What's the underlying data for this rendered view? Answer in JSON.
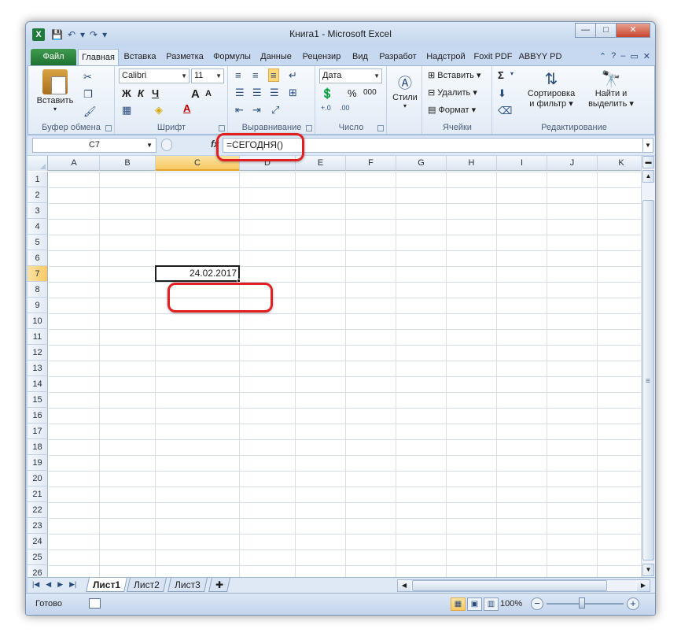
{
  "window": {
    "title": "Книга1 - Microsoft Excel",
    "app_icon_letter": "X",
    "controls": {
      "minimize": "—",
      "maximize": "□",
      "close": "✕"
    }
  },
  "qat": {
    "save": "💾",
    "undo": "↶",
    "redo": "↷",
    "more": "▾"
  },
  "tabs": [
    {
      "label": "Файл"
    },
    {
      "label": "Главная"
    },
    {
      "label": "Вставка"
    },
    {
      "label": "Разметка"
    },
    {
      "label": "Формулы"
    },
    {
      "label": "Данные"
    },
    {
      "label": "Рецензир"
    },
    {
      "label": "Вид"
    },
    {
      "label": "Разработ"
    },
    {
      "label": "Надстрой"
    },
    {
      "label": "Foxit PDF"
    },
    {
      "label": "ABBYY PD"
    }
  ],
  "ribbon": {
    "clipboard": {
      "label": "Буфер обмена",
      "paste": "Вставить"
    },
    "font": {
      "label": "Шрифт",
      "name": "Calibri",
      "size": "11",
      "bold": "Ж",
      "italic": "К",
      "underline": "Ч",
      "grow": "A",
      "shrink": "A"
    },
    "alignment": {
      "label": "Выравнивание"
    },
    "number": {
      "label": "Число",
      "format": "Дата",
      "percent": "%",
      "thousands": "000"
    },
    "styles": {
      "label": "Стили"
    },
    "cells": {
      "label": "Ячейки",
      "insert": "Вставить",
      "delete": "Удалить",
      "format": "Формат"
    },
    "editing": {
      "label": "Редактирование",
      "sort_line1": "Сортировка",
      "sort_line2": "и фильтр",
      "find_line1": "Найти и",
      "find_line2": "выделить",
      "sum": "Σ"
    }
  },
  "formula_bar": {
    "name_box": "C7",
    "fx": "fx",
    "formula": "=СЕГОДНЯ()"
  },
  "grid": {
    "columns": [
      "A",
      "B",
      "C",
      "D",
      "E",
      "F",
      "G",
      "H",
      "I",
      "J",
      "K"
    ],
    "rows": [
      "1",
      "2",
      "3",
      "4",
      "5",
      "6",
      "7",
      "8",
      "9",
      "10",
      "11",
      "12",
      "13",
      "14",
      "15",
      "16",
      "17",
      "18",
      "19",
      "20",
      "21",
      "22",
      "23",
      "24",
      "25",
      "26"
    ],
    "selected_column": "C",
    "selected_row": "7",
    "active_cell_value": "24.02.2017"
  },
  "sheets": [
    {
      "label": "Лист1",
      "active": true
    },
    {
      "label": "Лист2",
      "active": false
    },
    {
      "label": "Лист3",
      "active": false
    }
  ],
  "status": {
    "mode": "Готово",
    "zoom": "100%"
  },
  "colors": {
    "accent_red": "#e21f1f",
    "file_tab_green": "#1e7232",
    "selection_orange": "#f7c964"
  }
}
